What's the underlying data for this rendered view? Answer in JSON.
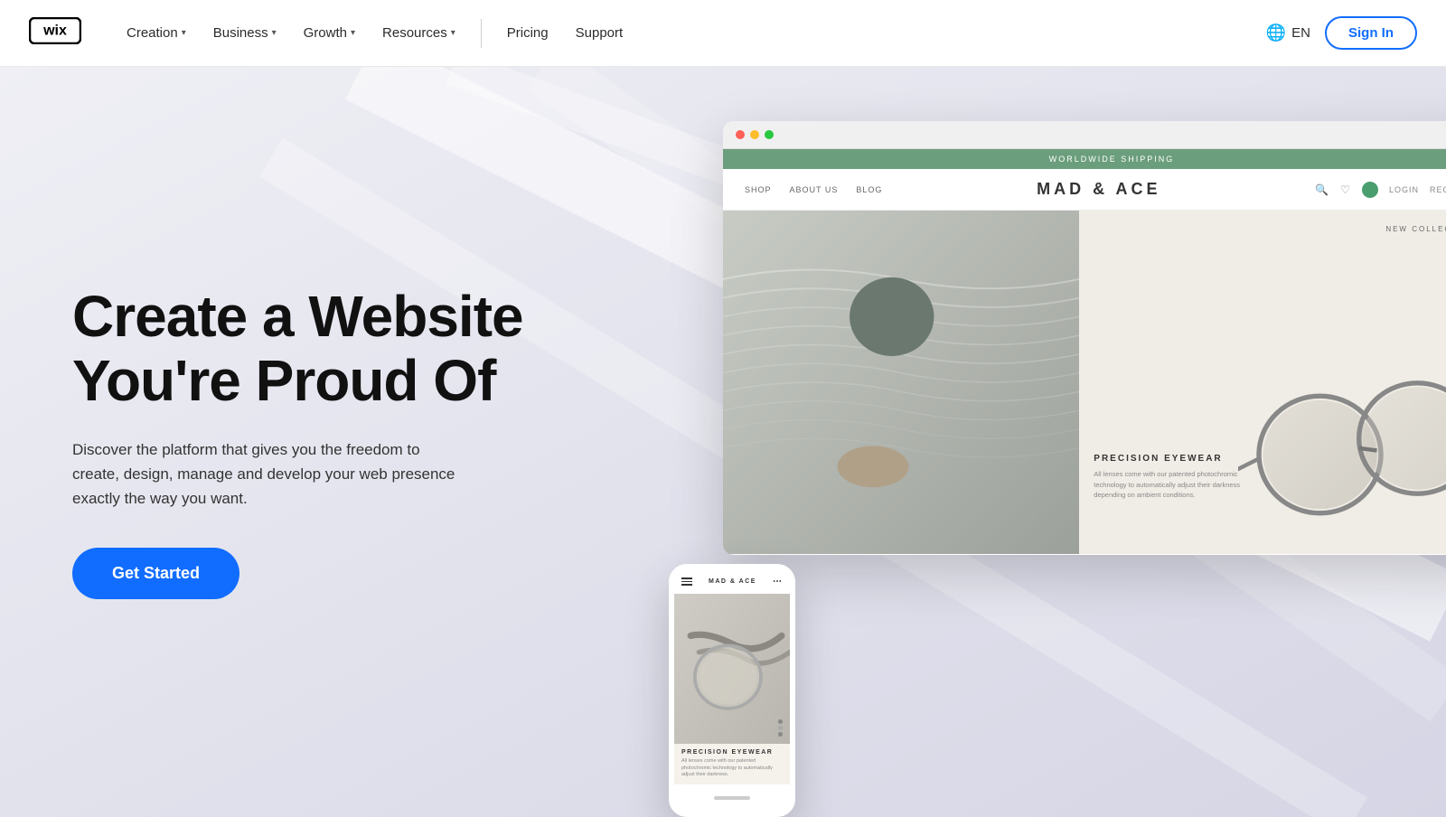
{
  "navbar": {
    "logo_text": "wix",
    "nav_items": [
      {
        "label": "Creation",
        "has_dropdown": true
      },
      {
        "label": "Business",
        "has_dropdown": true
      },
      {
        "label": "Growth",
        "has_dropdown": true
      },
      {
        "label": "Resources",
        "has_dropdown": true
      }
    ],
    "nav_items_plain": [
      {
        "label": "Pricing"
      },
      {
        "label": "Support"
      }
    ],
    "lang": "EN",
    "sign_in": "Sign In"
  },
  "hero": {
    "title_line1": "Create a Website",
    "title_line2": "You're Proud Of",
    "subtitle": "Discover the platform that gives you the freedom to create, design, manage and develop your web presence exactly the way you want.",
    "cta": "Get Started"
  },
  "mockup": {
    "banner_text": "Worldwide Shipping",
    "brand": "MAD & ACE",
    "nav_links": [
      "SHOP",
      "ABOUT US",
      "BLOG"
    ],
    "header_right": [
      "LOGIN",
      "REGISTER"
    ],
    "new_collection": "NEW COLLECTION  »",
    "product_title": "PRECISION EYEWEAR",
    "product_desc": "All lenses come with our patented photochromic technology to automatically adjust their darkness depending on ambient conditions.",
    "mobile_brand": "MAD & ACE"
  },
  "colors": {
    "accent_blue": "#116dff",
    "nav_border": "#e8e8e8",
    "mockup_banner": "#6b9e7c",
    "bg_gradient_start": "#f0f0f5",
    "bg_gradient_end": "#d8d8e8"
  }
}
